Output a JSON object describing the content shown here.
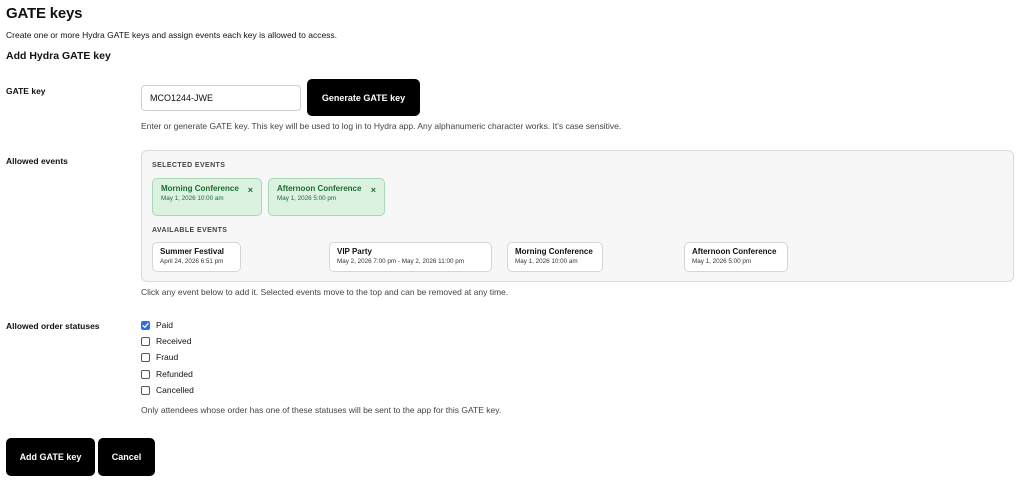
{
  "page": {
    "title": "GATE keys",
    "description": "Create one or more Hydra GATE keys and assign events each key is allowed to access.",
    "subtitle": "Add Hydra GATE key"
  },
  "gate_key": {
    "label": "GATE key",
    "value": "MCO1244-JWE",
    "generate_label": "Generate GATE key",
    "help": "Enter or generate GATE key. This key will be used to log in to Hydra app. Any alphanumeric character works. It's case sensitive."
  },
  "events": {
    "label": "Allowed events",
    "selected_heading": "SELECTED EVENTS",
    "available_heading": "AVAILABLE EVENTS",
    "selected": [
      {
        "name": "Morning Conference",
        "date": "May 1, 2026 10:00 am"
      },
      {
        "name": "Afternoon Conference",
        "date": "May 1, 2026 5:00 pm"
      }
    ],
    "available": [
      {
        "name": "Summer Festival",
        "date": "April 24, 2026 6:51 pm"
      },
      {
        "name": "VIP Party",
        "date": "May 2, 2026 7:00 pm - May 2, 2026 11:00 pm"
      },
      {
        "name": "Morning Conference",
        "date": "May 1, 2026 10:00 am"
      },
      {
        "name": "Afternoon Conference",
        "date": "May 1, 2026 5:00 pm"
      }
    ],
    "remove_glyph": "×",
    "help": "Click any event below to add it. Selected events move to the top and can be removed at any time."
  },
  "statuses": {
    "label": "Allowed order statuses",
    "options": [
      {
        "label": "Paid",
        "checked": true
      },
      {
        "label": "Received",
        "checked": false
      },
      {
        "label": "Fraud",
        "checked": false
      },
      {
        "label": "Refunded",
        "checked": false
      },
      {
        "label": "Cancelled",
        "checked": false
      }
    ],
    "help": "Only attendees whose order has one of these statuses will be sent to the app for this GATE key."
  },
  "actions": {
    "add_label": "Add GATE key",
    "cancel_label": "Cancel"
  },
  "colors": {
    "primary_button": "#000000",
    "selected_chip_bg": "#dcf2e1",
    "selected_chip_text": "#1c6b2f",
    "checkbox_checked": "#2f6fe0"
  },
  "icons": {
    "remove": "close-icon",
    "check": "check-icon"
  }
}
